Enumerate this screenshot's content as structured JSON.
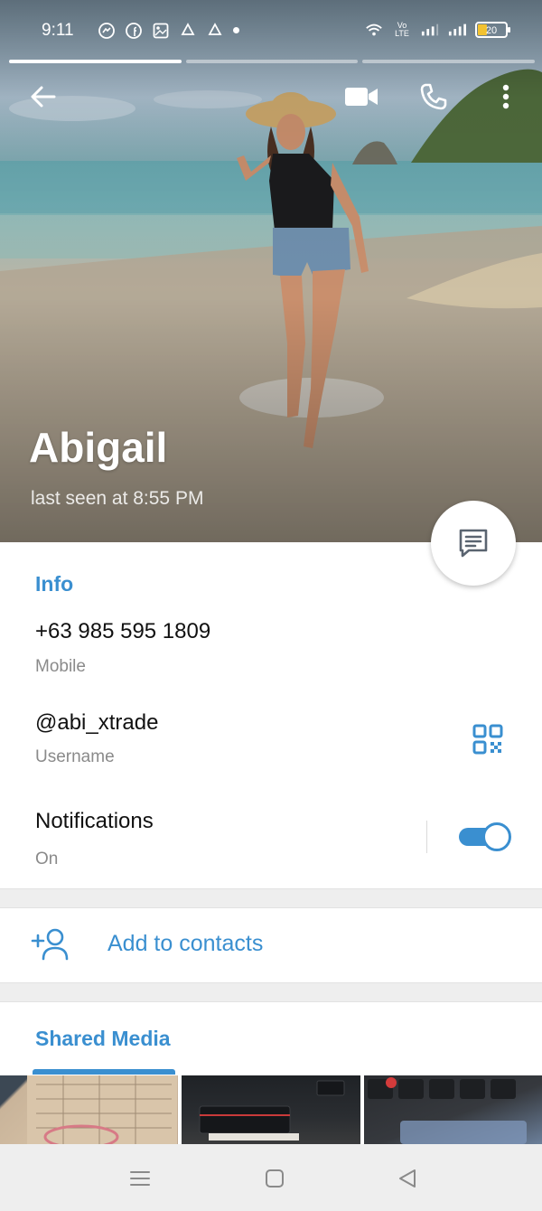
{
  "status_bar": {
    "time": "9:11",
    "left_icons": [
      "messenger-icon",
      "facebook-icon",
      "gallery-icon",
      "recycle-icon",
      "recycle-icon"
    ],
    "right_icons": [
      "wifi-icon",
      "volte-icon",
      "signal-icon",
      "signal-icon"
    ],
    "volte_text": "Vo LTE",
    "battery": "20"
  },
  "stories": {
    "count": 3,
    "active_index": 0
  },
  "profile": {
    "name": "Abigail",
    "last_seen": "last seen at 8:55 PM"
  },
  "info": {
    "section_title": "Info",
    "phone": "+63 985 595 1809",
    "phone_label": "Mobile",
    "username": "@abi_xtrade",
    "username_label": "Username",
    "notifications": "Notifications",
    "notifications_state": "On",
    "notifications_on": true
  },
  "actions": {
    "add_to_contacts": "Add to contacts"
  },
  "shared_media": {
    "tab_label": "Shared Media",
    "thumbnail_count": 3
  },
  "colors": {
    "accent": "#3a8fd0",
    "text_primary": "#111111",
    "text_secondary": "#8a8a8a"
  }
}
